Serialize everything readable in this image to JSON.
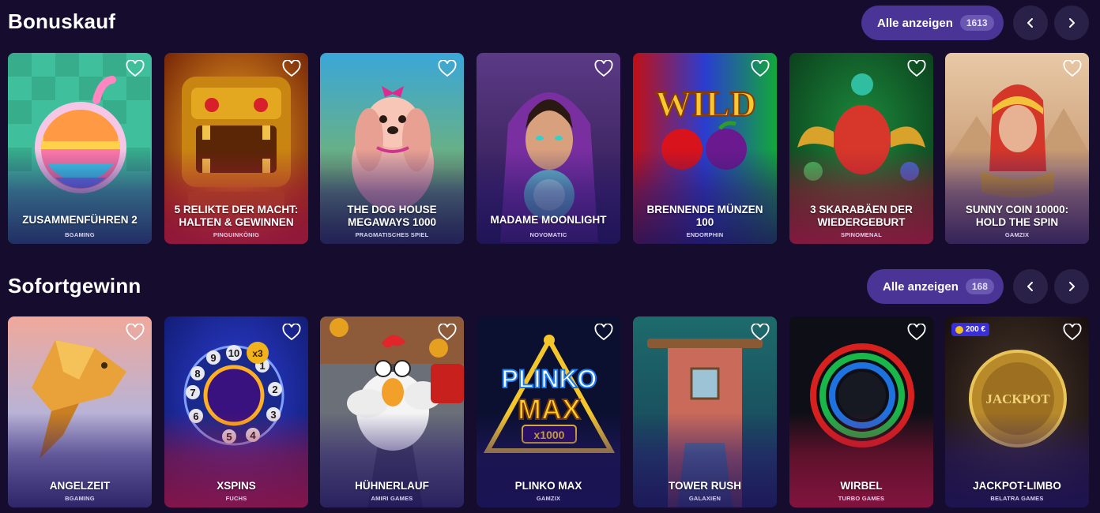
{
  "sections": [
    {
      "title": "Bonuskauf",
      "all_label": "Alle anzeigen",
      "count": "1613",
      "games": [
        {
          "title": "ZUSAMMENFÜHREN 2",
          "provider": "BGAMING"
        },
        {
          "title": "5 RELIKTE DER MACHT: HALTEN & GEWINNEN",
          "provider": "PINGUINKÖNIG"
        },
        {
          "title": "THE DOG HOUSE MEGAWAYS 1000",
          "provider": "PRAGMATISCHES SPIEL"
        },
        {
          "title": "MADAME MOONLIGHT",
          "provider": "NOVOMATIC"
        },
        {
          "title": "BRENNENDE MÜNZEN 100",
          "provider": "ENDORPHIN"
        },
        {
          "title": "3 SKARABÄEN DER WIEDERGEBURT",
          "provider": "SPINOMENAL"
        },
        {
          "title": "SUNNY COIN 10000: HOLD THE SPIN",
          "provider": "GAMZIX"
        }
      ]
    },
    {
      "title": "Sofortgewinn",
      "all_label": "Alle anzeigen",
      "count": "168",
      "games": [
        {
          "title": "ANGELZEIT",
          "provider": "BGAMING"
        },
        {
          "title": "XSPINS",
          "provider": "FUCHS"
        },
        {
          "title": "HÜHNERLAUF",
          "provider": "AMIRI GAMES"
        },
        {
          "title": "PLINKO MAX",
          "provider": "GAMZIX"
        },
        {
          "title": "TOWER RUSH",
          "provider": "GALAXIEN"
        },
        {
          "title": "WIRBEL",
          "provider": "TURBO GAMES"
        },
        {
          "title": "JACKPOT-LIMBO",
          "provider": "BELATRA GAMES",
          "badge": "200 €"
        }
      ]
    }
  ],
  "art_text": {
    "wild": "WILD",
    "plinko": "PLINKO",
    "max": "MAX",
    "x1000": "x1000",
    "jackpot": "JACKPOT",
    "x3": "x3",
    "dial_numbers": [
      "10",
      "1",
      "2",
      "3",
      "4",
      "5",
      "6",
      "7",
      "8",
      "9"
    ]
  },
  "colors": {
    "background": "#150c2e",
    "button": "#4a3596",
    "arrow_button": "#2a2148",
    "badge": "#3a2fd6"
  },
  "icons": {
    "favorite": "heart-outline-icon",
    "prev": "chevron-left-icon",
    "next": "chevron-right-icon",
    "coin": "coin-icon"
  }
}
